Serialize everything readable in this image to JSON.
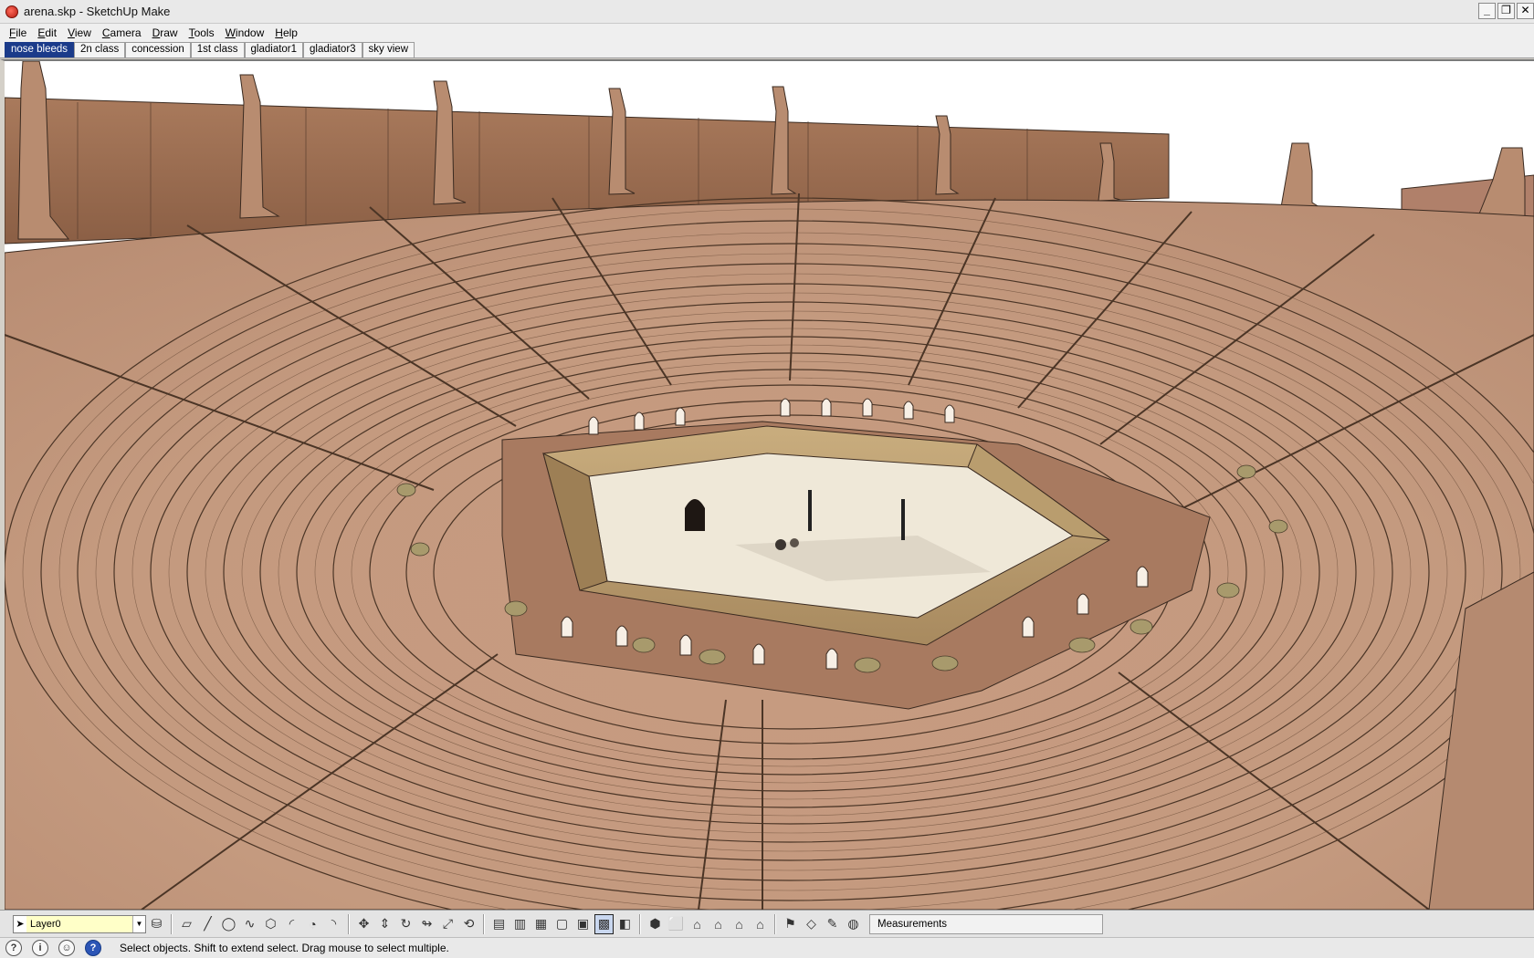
{
  "window": {
    "title": "arena.skp - SketchUp Make"
  },
  "menu": [
    {
      "label": "File",
      "key": "F",
      "rest": "ile"
    },
    {
      "label": "Edit",
      "key": "E",
      "rest": "dit"
    },
    {
      "label": "View",
      "key": "V",
      "rest": "iew"
    },
    {
      "label": "Camera",
      "key": "C",
      "rest": "amera"
    },
    {
      "label": "Draw",
      "key": "D",
      "rest": "raw"
    },
    {
      "label": "Tools",
      "key": "T",
      "rest": "ools"
    },
    {
      "label": "Window",
      "key": "W",
      "rest": "indow"
    },
    {
      "label": "Help",
      "key": "H",
      "rest": "elp"
    }
  ],
  "scenes": {
    "active": "nose bleeds",
    "tabs": [
      "nose bleeds",
      "2n class",
      "concession",
      "1st class",
      "gladiator1",
      "gladiator3",
      "sky view"
    ]
  },
  "toolbar": {
    "layer": "Layer0",
    "measurements_label": "Measurements"
  },
  "status": {
    "text": "Select objects. Shift to extend select. Drag mouse to select multiple."
  },
  "colors": {
    "active_tab": "#1b3b8a",
    "stone": "#c69a7e",
    "stone_dark": "#8f6a52",
    "arena_floor": "#efe8d8",
    "layer_field": "#ffffc8"
  }
}
